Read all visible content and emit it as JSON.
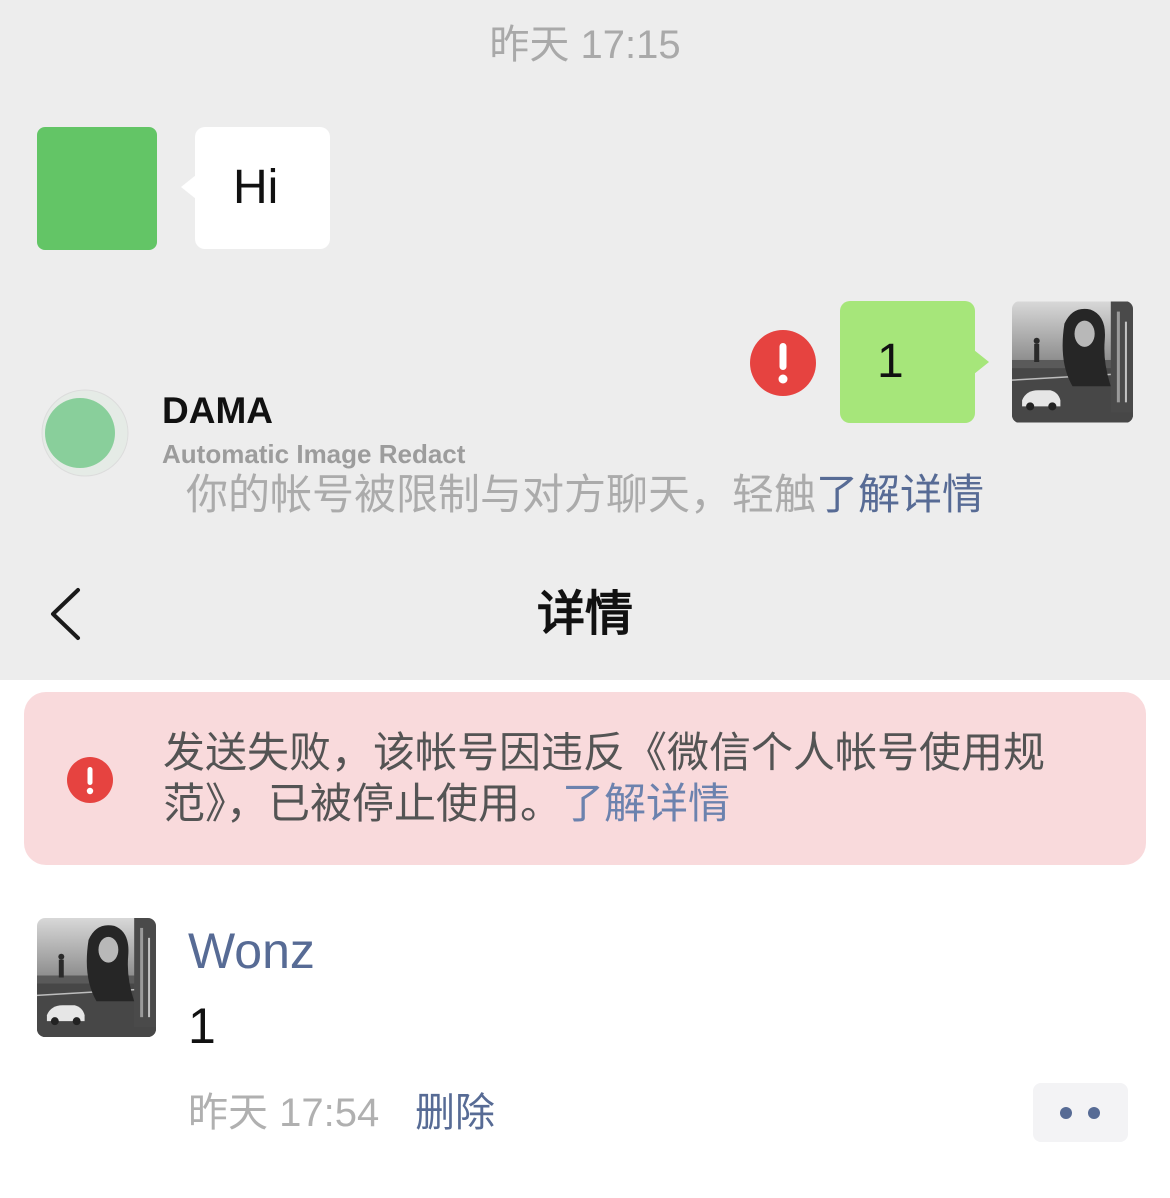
{
  "colors": {
    "link": "#576b95",
    "alert-link": "#6c82ae",
    "error": "#e64340",
    "outgoing-bubble": "#a6e67a",
    "incoming-avatar": "#63c566",
    "alert-bg": "#f9dadc"
  },
  "chat": {
    "timestamp": "昨天 17:15",
    "incoming_message": {
      "text": "Hi"
    },
    "outgoing_message": {
      "text": "1",
      "status_icon": "error-icon"
    },
    "restriction_notice": {
      "text": "你的帐号被限制与对方聊天，轻触",
      "link": "了解详情"
    }
  },
  "watermark": {
    "brand": "DAMA",
    "tagline": "Automatic Image Redact"
  },
  "navbar": {
    "back_icon": "chevron-left-icon",
    "title": "详情"
  },
  "alert": {
    "icon": "error-icon",
    "text": "发送失败，该帐号因违反《微信个人帐号使用规范》，已被停止使用。",
    "link": "了解详情"
  },
  "message_detail": {
    "sender": "Wonz",
    "content": "1",
    "time": "昨天 17:54",
    "delete_label": "删除",
    "more_icon": "more-icon"
  }
}
